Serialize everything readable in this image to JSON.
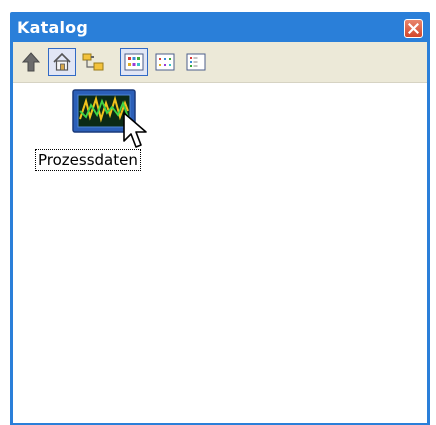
{
  "window": {
    "title": "Katalog",
    "title_bar_color": "#2a7fd9"
  },
  "toolbar": {
    "buttons": [
      {
        "icon": "up-arrow-icon"
      },
      {
        "icon": "home-icon",
        "pressed": true
      },
      {
        "icon": "tree-structure-icon"
      },
      {
        "icon": "large-icons-view-icon",
        "pressed": true
      },
      {
        "icon": "small-icons-view-icon"
      },
      {
        "icon": "list-view-icon"
      }
    ]
  },
  "catalog": {
    "items": [
      {
        "label": "Prozessdaten",
        "icon": "process-data-monitor-icon",
        "selected": true
      }
    ]
  }
}
